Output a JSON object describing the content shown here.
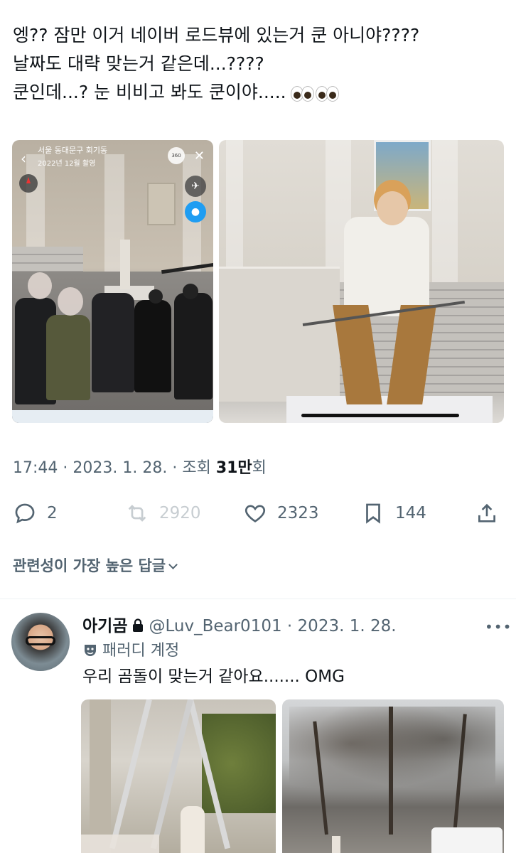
{
  "tweet": {
    "lines": [
      "엥?? 잠만 이거 네이버 로드뷰에 있는거 쿤 아니야????",
      "날짜도 대략 맞는거 같은데...????",
      "쿤인데...? 눈 비비고 봐도 쿤이야....."
    ],
    "emoji_icon": "eyes-emoji"
  },
  "photo1": {
    "location": "서울 동대문구 회기동",
    "date": "2022년 12월 촬영",
    "badge_360": "360"
  },
  "meta": {
    "time": "17:44",
    "date": "2023. 1. 28.",
    "views_label": "조회",
    "views_value": "31만",
    "views_unit": "회"
  },
  "actions": {
    "replies": "2",
    "retweets": "2920",
    "likes": "2323",
    "bookmarks": "144"
  },
  "sort_label": "관련성이 가장 높은 답글",
  "reply": {
    "name": "아기곰",
    "handle": "@Luv_Bear0101",
    "date": "2023. 1. 28.",
    "parody_label": "패러디 계정",
    "text": "우리 곰돌이 맞는거 같아요....... OMG"
  },
  "colors": {
    "text": "#0f1419",
    "secondary": "#536471",
    "divider": "#eff3f4",
    "retweet_disabled": "#c7cdd1"
  }
}
